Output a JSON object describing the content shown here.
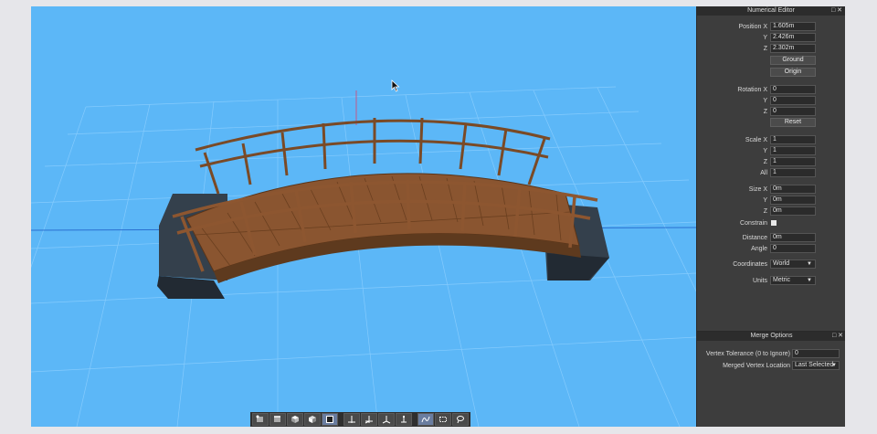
{
  "numerical_editor": {
    "title": "Numerical Editor",
    "position": {
      "x_label": "Position X",
      "x": "1.605m",
      "y_label": "Y",
      "y": "2.426m",
      "z_label": "Z",
      "z": "2.302m",
      "ground": "Ground",
      "origin": "Origin"
    },
    "rotation": {
      "x_label": "Rotation X",
      "x": "0",
      "y_label": "Y",
      "y": "0",
      "z_label": "Z",
      "z": "0",
      "reset": "Reset"
    },
    "scale": {
      "x_label": "Scale X",
      "x": "1",
      "y_label": "Y",
      "y": "1",
      "z_label": "Z",
      "z": "1",
      "all_label": "All",
      "all": "1"
    },
    "size": {
      "x_label": "Size X",
      "x": "0m",
      "y_label": "Y",
      "y": "0m",
      "z_label": "Z",
      "z": "0m"
    },
    "constrain_label": "Constrain",
    "constrain_checked": true,
    "distance_label": "Distance",
    "distance": "0m",
    "angle_label": "Angle",
    "angle": "0",
    "coordinates_label": "Coordinates",
    "coordinates": "World",
    "units_label": "Units",
    "units": "Metric"
  },
  "merge_options": {
    "title": "Merge Options",
    "vertex_tolerance_label": "Vertex Tolerance (0 to Ignore)",
    "vertex_tolerance": "0",
    "merged_vertex_location_label": "Merged Vertex Location",
    "merged_vertex_location": "Last Selected"
  },
  "colors": {
    "viewport_bg": "#5cb7f7",
    "panel_bg": "#3d3d3d",
    "wood": "#8a5530",
    "stone": "#2e3640"
  },
  "toolbar_icons": [
    "vertex-tool-icon",
    "edge-tool-icon",
    "face-tool-icon",
    "object-tool-icon",
    "cube-tool-icon",
    "move-icon",
    "move-vertex-icon",
    "rotate-icon",
    "scale-icon",
    "curve-icon",
    "rect-select-icon",
    "lasso-icon"
  ]
}
